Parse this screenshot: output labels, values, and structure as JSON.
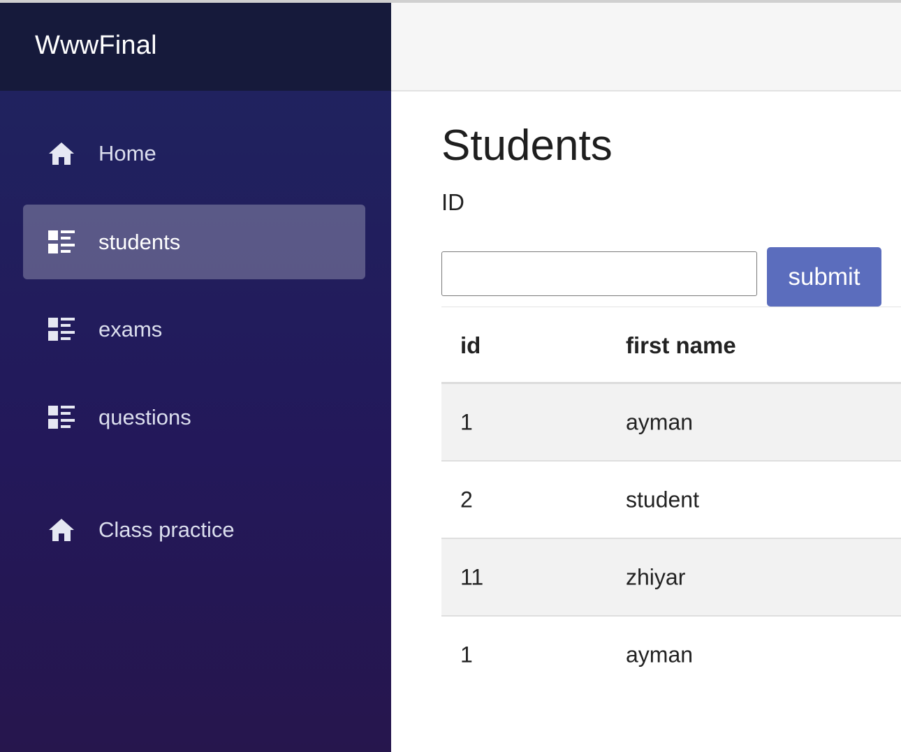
{
  "app": {
    "brand": "WwwFinal"
  },
  "sidebar": {
    "items": [
      {
        "label": "Home",
        "icon": "home-icon"
      },
      {
        "label": "students",
        "icon": "list-icon",
        "active": true
      },
      {
        "label": "exams",
        "icon": "list-icon"
      },
      {
        "label": "questions",
        "icon": "list-icon"
      },
      {
        "label": "Class practice",
        "icon": "home-icon"
      }
    ]
  },
  "page": {
    "title": "Students",
    "form": {
      "id_label": "ID",
      "id_value": "",
      "submit_label": "submit"
    },
    "table": {
      "headers": [
        "id",
        "first name"
      ],
      "rows": [
        [
          "1",
          "ayman"
        ],
        [
          "2",
          "student"
        ],
        [
          "11",
          "zhiyar"
        ],
        [
          "1",
          "ayman"
        ]
      ]
    }
  },
  "colors": {
    "sidebar_top": "#1f2560",
    "sidebar_bottom": "#26164d",
    "brand_bar": "#161a3b",
    "submit_button": "#5b6dbd"
  }
}
